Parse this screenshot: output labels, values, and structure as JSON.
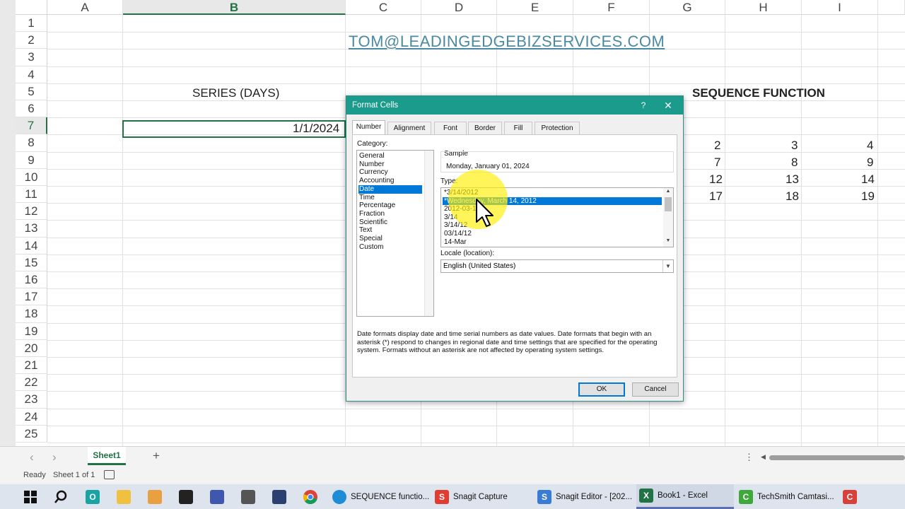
{
  "columns": [
    "A",
    "B",
    "C",
    "D",
    "E",
    "F",
    "G",
    "H",
    "I"
  ],
  "rows": [
    "1",
    "2",
    "3",
    "4",
    "5",
    "6",
    "7",
    "8",
    "9",
    "10",
    "11",
    "12",
    "13",
    "14",
    "15",
    "16",
    "17",
    "18",
    "19",
    "20",
    "21",
    "22",
    "23",
    "24",
    "25"
  ],
  "cells": {
    "email": "TOM@LEADINGEDGEBIZSERVICES.COM",
    "series_header": "SERIES (DAYS)",
    "b7": "1/1/2024",
    "sequence_header": "SEQUENCE FUNCTION",
    "g8": "2",
    "h8": "3",
    "i8": "4",
    "g9": "7",
    "h9": "8",
    "i9": "9",
    "g10": "12",
    "h10": "13",
    "i10": "14",
    "g11": "17",
    "h11": "18",
    "i11": "19"
  },
  "dialog": {
    "title": "Format Cells",
    "help": "?",
    "close": "✕",
    "tabs": [
      "Number",
      "Alignment",
      "Font",
      "Border",
      "Fill",
      "Protection"
    ],
    "category_label": "Category:",
    "categories": [
      "General",
      "Number",
      "Currency",
      "Accounting",
      "Date",
      "Time",
      "Percentage",
      "Fraction",
      "Scientific",
      "Text",
      "Special",
      "Custom"
    ],
    "selected_category": "Date",
    "sample_label": "Sample",
    "sample_value": "Monday, January 01, 2024",
    "type_label": "Type:",
    "types": [
      "*3/14/2012",
      "*Wednesday, March 14, 2012",
      "2012-03-14",
      "3/14",
      "3/14/12",
      "03/14/12",
      "14-Mar"
    ],
    "selected_type": "*Wednesday, March 14, 2012",
    "locale_label": "Locale (location):",
    "locale_value": "English (United States)",
    "description": "Date formats display date and time serial numbers as date values.  Date formats that begin with an asterisk (*) respond to changes in regional date and time settings that are specified for the operating system. Formats without an asterisk are not affected by operating system settings.",
    "ok_label": "OK",
    "cancel_label": "Cancel"
  },
  "sheet_tabs": {
    "prev": "‹",
    "next": "›",
    "active_sheet": "Sheet1",
    "add": "+",
    "more": "⋮"
  },
  "status": {
    "ready": "Ready",
    "sheet_info": "Sheet 1 of 1"
  },
  "taskbar": {
    "items": [
      {
        "label": "SEQUENCE functio..."
      },
      {
        "label": "Snagit Capture"
      },
      {
        "label": "Snagit Editor - [202..."
      },
      {
        "label": "Book1 - Excel"
      },
      {
        "label": "TechSmith Camtasi..."
      }
    ]
  },
  "colors": {
    "excel_green": "#217346",
    "dialog_title": "#1b9b8c",
    "selection_blue": "#0078d7",
    "highlight": "#ffee00"
  }
}
